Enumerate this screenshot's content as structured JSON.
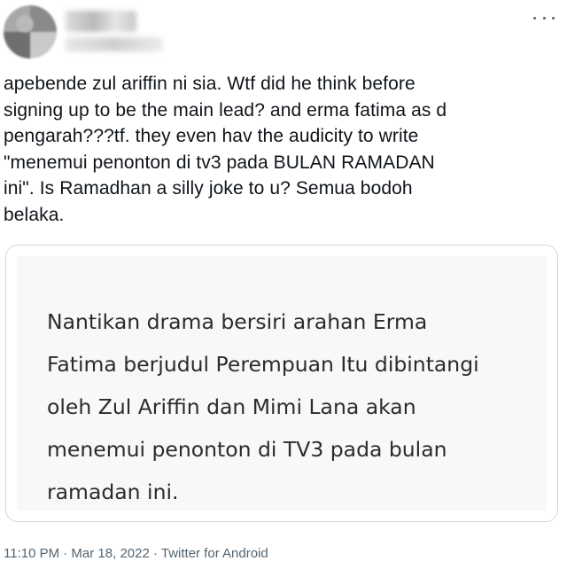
{
  "tweet": {
    "text_lines": [
      "apebende zul ariffin ni sia. Wtf did he think before",
      "signing up to be the main lead? and erma fatima as d",
      "pengarah???tf. they even hav the audicity to write",
      "\"menemui penonton di tv3 pada BULAN RAMADAN",
      "ini\". Is Ramadhan a silly joke to u? Semua bodoh",
      "belaka."
    ],
    "timestamp": "11:10 PM · Mar 18, 2022 · Twitter for Android"
  },
  "card": {
    "lines": [
      "Nantikan drama bersiri arahan Erma",
      "Fatima berjudul Perempuan Itu dibintangi",
      "oleh Zul Ariffin dan Mimi Lana akan",
      "menemui penonton di TV3 pada bulan",
      "ramadan ini."
    ]
  },
  "icons": {
    "more": "more-horizontal-icon"
  }
}
